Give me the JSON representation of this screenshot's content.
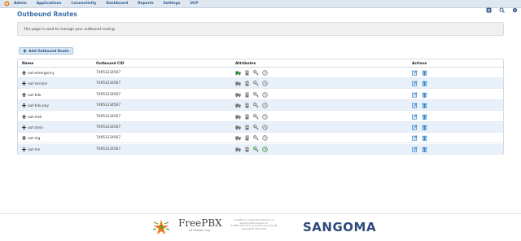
{
  "topnav": {
    "items": [
      "Admin",
      "Applications",
      "Connectivity",
      "Dashboard",
      "Reports",
      "Settings",
      "UCP"
    ],
    "right_icons": [
      "tool-icon",
      "search-icon",
      "gear-icon"
    ]
  },
  "page": {
    "title": "Outbound Routes",
    "info": "This page is used to manage your outbound routing."
  },
  "toolbar": {
    "add_label": "Add Outbound Route"
  },
  "grid": {
    "columns": [
      "Name",
      "Outbound CID",
      "Attributes",
      "Actions"
    ],
    "rows": [
      {
        "name": "out-emergency",
        "cid": "74951234567",
        "emergency": true,
        "highlight_key": false
      },
      {
        "name": "out-service",
        "cid": "74951234567",
        "emergency": false,
        "highlight_key": false
      },
      {
        "name": "out-kdu",
        "cid": "74951234567",
        "emergency": false,
        "highlight_key": false
      },
      {
        "name": "out-kdu-pay",
        "cid": "74951234567",
        "emergency": false,
        "highlight_key": false
      },
      {
        "name": "out-msk",
        "cid": "74951234567",
        "emergency": false,
        "highlight_key": false
      },
      {
        "name": "out-zona",
        "cid": "74951234567",
        "emergency": false,
        "highlight_key": false
      },
      {
        "name": "out-mg",
        "cid": "74951234567",
        "emergency": false,
        "highlight_key": false
      },
      {
        "name": "out-mn",
        "cid": "74951234567",
        "emergency": false,
        "highlight_key": true
      }
    ]
  },
  "footer": {
    "brand": "FreePBX",
    "tagline": "let freedom ring™",
    "legal": [
      "FreePBX is a registered trademark of",
      "Sangoma Technologies Inc.",
      "FreePBX 14.0.13.4 is licensed under the GPL",
      "Copyright© 2007-2018"
    ],
    "company": "SANGOMA"
  },
  "colors": {
    "accent": "#2c5a8a",
    "row_alt": "#e8f1fa",
    "emergency_green": "#3a8a3a",
    "icon_blue": "#2f7fc9"
  }
}
